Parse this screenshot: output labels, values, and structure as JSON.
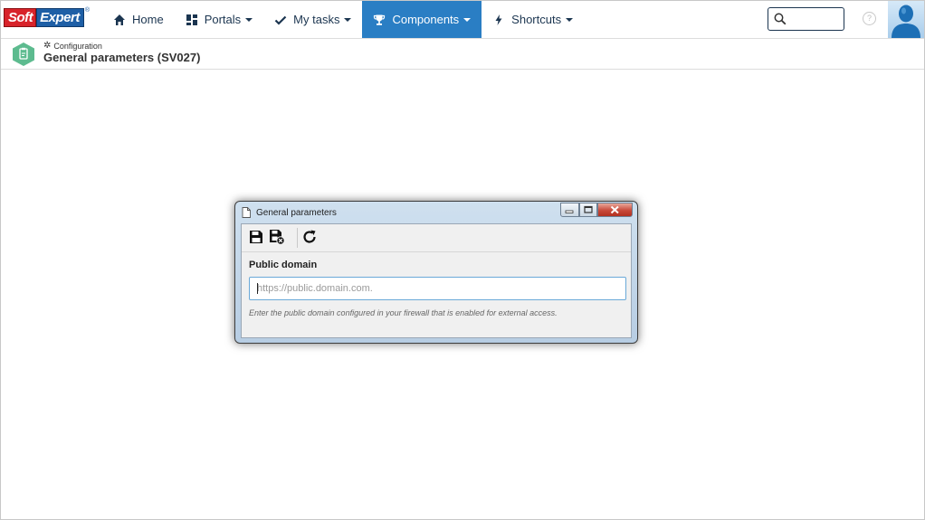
{
  "brand": {
    "logo_left": "Soft",
    "logo_right": "Expert",
    "registered": "®"
  },
  "nav": {
    "items": [
      {
        "label": "Home",
        "icon": "home-icon",
        "dropdown": false,
        "active": false
      },
      {
        "label": "Portals",
        "icon": "dashboard-icon",
        "dropdown": true,
        "active": false
      },
      {
        "label": "My tasks",
        "icon": "check-icon",
        "dropdown": true,
        "active": false
      },
      {
        "label": "Components",
        "icon": "trophy-icon",
        "dropdown": true,
        "active": true
      },
      {
        "label": "Shortcuts",
        "icon": "lightning-icon",
        "dropdown": true,
        "active": false
      }
    ],
    "active_color": "#2a7ec4"
  },
  "header": {
    "breadcrumb": "Configuration",
    "title": "General parameters (SV027)"
  },
  "dialog": {
    "title": "General parameters",
    "field_label": "Public domain",
    "field_value": "",
    "field_placeholder": "https://public.domain.com.",
    "field_hint": "Enter the public domain configured in your firewall that is enabled for external access."
  },
  "colors": {
    "nav_text": "#1b3550",
    "logo_red": "#d8232a",
    "logo_blue": "#1e5fa6",
    "hex_badge": "#5dbb8f"
  }
}
